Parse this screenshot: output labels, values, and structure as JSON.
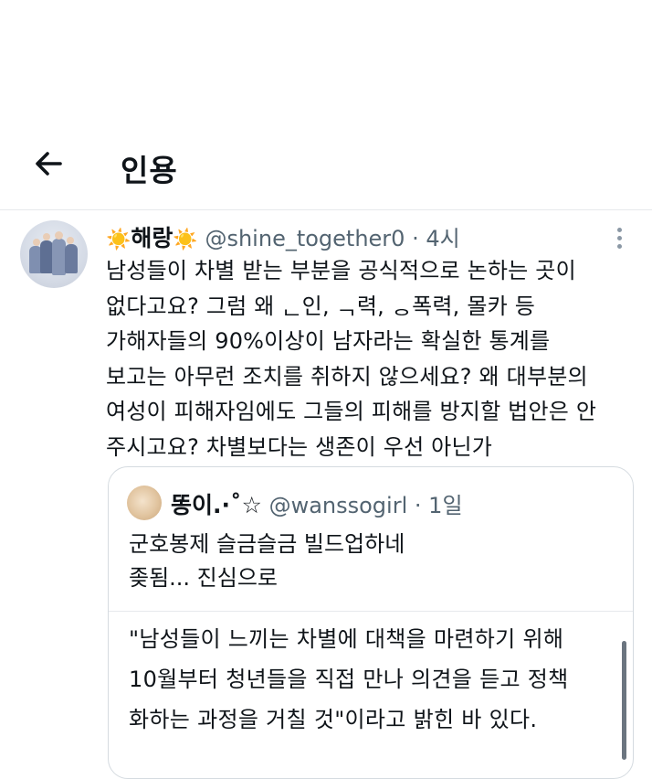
{
  "header": {
    "title": "인용",
    "back_icon": "arrow-left-icon"
  },
  "tweet": {
    "display_name": "해랑",
    "name_emoji": "☀️",
    "handle": "@shine_together0",
    "separator": "·",
    "time": "4시",
    "more_icon": "vertical-ellipsis-icon",
    "text": "남성들이 차별 받는 부분을 공식적으로 논하는 곳이\n없다고요? 그럼 왜 ᆫ인, ᆨ력, ᆼ폭력, 몰카 등\n가해자들의 90%이상이 남자라는 확실한 통계를\n보고는 아무런 조치를 취하지 않으세요? 왜 대부분의\n여성이 피해자임에도 그들의 피해를 방지할 법안은 안\n주시고요? 차별보다는 생존이 우선 아닌가"
  },
  "quoted": {
    "display_name": "똥이.·˚☆",
    "handle": "@wanssogirl",
    "separator": "·",
    "time": "1일",
    "text": "군호봉제 슬금슬금 빌드업하네\n좆됨... 진심으로",
    "card_text": "\"남성들이 느끼는 차별에 대책을 마련하기 위해\n10월부터 청년들을 직접 만나 의견을 듣고 정책\n화하는 과정을 거칠 것\"이라고 밝힌 바 있다."
  }
}
